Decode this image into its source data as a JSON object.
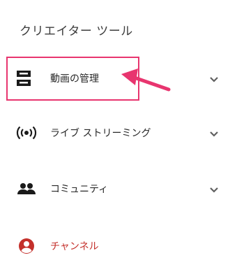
{
  "sidebar": {
    "section_title": "クリエイター ツール",
    "items": [
      {
        "label": "動画の管理",
        "icon": "video-manager-icon",
        "expandable": true,
        "highlighted": true
      },
      {
        "label": "ライブ ストリーミング",
        "icon": "live-broadcast-icon",
        "expandable": true
      },
      {
        "label": "コミュニティ",
        "icon": "people-icon",
        "expandable": true
      },
      {
        "label": "チャンネル",
        "icon": "account-circle-icon",
        "expandable": false
      }
    ]
  },
  "colors": {
    "highlight": "#e8356f",
    "channel_accent": "#c4302b",
    "icon": "#1a1a1a",
    "chevron": "#606060"
  }
}
